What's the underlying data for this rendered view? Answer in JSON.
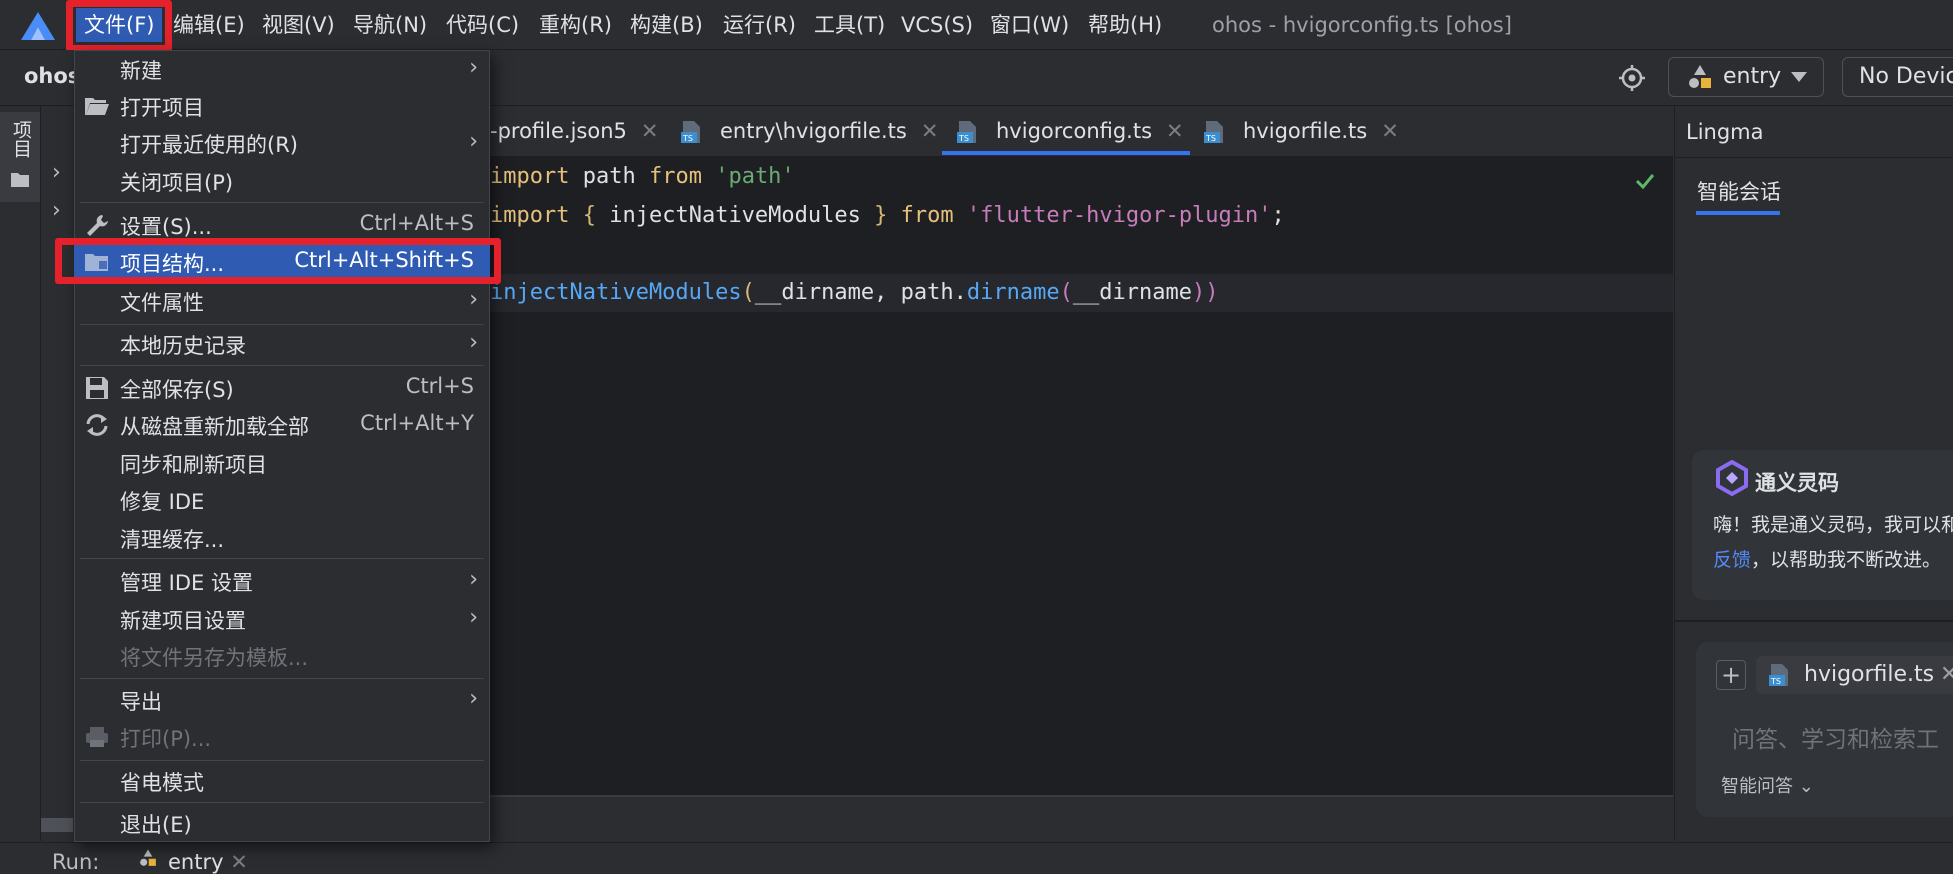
{
  "menubar": {
    "items": [
      "文件(F)",
      "编辑(E)",
      "视图(V)",
      "导航(N)",
      "代码(C)",
      "重构(R)",
      "构建(B)",
      "运行(R)",
      "工具(T)",
      "VCS(S)",
      "窗口(W)",
      "帮助(H)"
    ],
    "window_title": "ohos - hvigorconfig.ts [ohos]"
  },
  "toolbar": {
    "project": "ohos",
    "run_config": "entry",
    "device": "No Devic"
  },
  "left_strip": {
    "project_tab": "项目"
  },
  "editor": {
    "tabs": [
      {
        "label": "-profile.json5"
      },
      {
        "label": "entry\\hvigorfile.ts"
      },
      {
        "label": "hvigorconfig.ts"
      },
      {
        "label": "hvigorfile.ts"
      }
    ],
    "active_tab": "hvigorconfig.ts",
    "code": {
      "l1_import": "import",
      "l1_name": "path",
      "l1_from": "from",
      "l1_str": "'path'",
      "l2_import": "import",
      "l2_lb": "{",
      "l2_name": "injectNativeModules",
      "l2_rb": "}",
      "l2_from": "from",
      "l2_str": "'flutter-hvigor-plugin'",
      "l2_semi": ";",
      "l4_fn": "injectNativeModules",
      "l4_lp": "(",
      "l4_a1": "__dirname, path.",
      "l4_fn2": "dirname",
      "l4_lp2": "(",
      "l4_a2": "__dirname",
      "l4_rp": "))"
    }
  },
  "file_menu": {
    "items": [
      {
        "label": "新建",
        "shortcut": "",
        "submenu": true,
        "icon": ""
      },
      {
        "label": "打开项目",
        "shortcut": "",
        "submenu": false,
        "icon": "folder-open-icon"
      },
      {
        "label": "打开最近使用的(R)",
        "shortcut": "",
        "submenu": true,
        "icon": ""
      },
      {
        "label": "关闭项目(P)",
        "shortcut": "",
        "submenu": false,
        "icon": ""
      },
      {
        "label": "设置(S)...",
        "shortcut": "Ctrl+Alt+S",
        "submenu": false,
        "icon": "wrench-icon"
      },
      {
        "label": "项目结构...",
        "shortcut": "Ctrl+Alt+Shift+S",
        "submenu": false,
        "icon": "project-structure-icon"
      },
      {
        "label": "文件属性",
        "shortcut": "",
        "submenu": true,
        "icon": ""
      },
      {
        "label": "本地历史记录",
        "shortcut": "",
        "submenu": true,
        "icon": ""
      },
      {
        "label": "全部保存(S)",
        "shortcut": "Ctrl+S",
        "submenu": false,
        "icon": "save-icon"
      },
      {
        "label": "从磁盘重新加载全部",
        "shortcut": "Ctrl+Alt+Y",
        "submenu": false,
        "icon": "reload-icon"
      },
      {
        "label": "同步和刷新项目",
        "shortcut": "",
        "submenu": false,
        "icon": ""
      },
      {
        "label": "修复 IDE",
        "shortcut": "",
        "submenu": false,
        "icon": ""
      },
      {
        "label": "清理缓存...",
        "shortcut": "",
        "submenu": false,
        "icon": ""
      },
      {
        "label": "管理 IDE 设置",
        "shortcut": "",
        "submenu": true,
        "icon": ""
      },
      {
        "label": "新建项目设置",
        "shortcut": "",
        "submenu": true,
        "icon": ""
      },
      {
        "label": "将文件另存为模板...",
        "shortcut": "",
        "submenu": false,
        "icon": "",
        "disabled": true
      },
      {
        "label": "导出",
        "shortcut": "",
        "submenu": true,
        "icon": ""
      },
      {
        "label": "打印(P)...",
        "shortcut": "",
        "submenu": false,
        "icon": "printer-icon",
        "disabled": true
      },
      {
        "label": "省电模式",
        "shortcut": "",
        "submenu": false,
        "icon": ""
      },
      {
        "label": "退出(E)",
        "shortcut": "",
        "submenu": false,
        "icon": ""
      }
    ],
    "selected": "项目结构..."
  },
  "lingma": {
    "title": "Lingma",
    "tab": "智能会话",
    "welcome_title": "通义灵码",
    "welcome_line1": "嗨！我是通义灵码，我可以和",
    "welcome_link": "反馈",
    "welcome_line2_rest": "，以帮助我不断改进。",
    "file_chip": "hvigorfile.ts",
    "placeholder": "问答、学习和检索工",
    "mode": "智能问答"
  },
  "bottom": {
    "run_label": "Run:",
    "run_entry": "entry"
  },
  "colors": {
    "accent": "#3574f0",
    "selection": "#2f5bb3",
    "highlight_box": "#e5222b",
    "background": "#2b2d30",
    "editor_bg": "#1e1f22"
  }
}
